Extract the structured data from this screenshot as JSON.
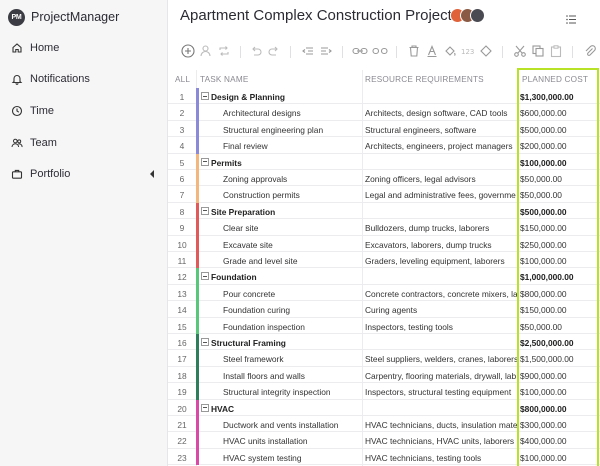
{
  "app": {
    "brand_abbr": "PM",
    "brand_name": "ProjectManager"
  },
  "sidebar": {
    "items": [
      {
        "label": "Home",
        "icon": "home-icon"
      },
      {
        "label": "Notifications",
        "icon": "bell-icon"
      },
      {
        "label": "Time",
        "icon": "clock-icon"
      },
      {
        "label": "Team",
        "icon": "team-icon"
      },
      {
        "label": "Portfolio",
        "icon": "briefcase-icon"
      }
    ]
  },
  "header": {
    "title": "Apartment Complex Construction Project"
  },
  "colors": {
    "highlight": "#b7e225",
    "design": "#8b8ad9",
    "permits": "#f3b77d",
    "site": "#e15a5a",
    "foundation": "#58c77a",
    "framing": "#2e7d5b",
    "hvac": "#d94aa6"
  },
  "grid": {
    "columns": {
      "all": "ALL",
      "task": "TASK NAME",
      "resource": "RESOURCE REQUIREMENTS",
      "cost": "PLANNED COST"
    },
    "rows": [
      {
        "num": "1",
        "name": "Design & Planning",
        "resource": "",
        "cost": "$1,300,000.00",
        "group": true,
        "color": "design"
      },
      {
        "num": "2",
        "name": "Architectural designs",
        "resource": "Architects, design software, CAD tools",
        "cost": "$600,000.00",
        "group": false,
        "color": "design"
      },
      {
        "num": "3",
        "name": "Structural engineering plan",
        "resource": "Structural engineers, software",
        "cost": "$500,000.00",
        "group": false,
        "color": "design"
      },
      {
        "num": "4",
        "name": "Final review",
        "resource": "Architects, engineers, project managers",
        "cost": "$200,000.00",
        "group": false,
        "color": "design"
      },
      {
        "num": "5",
        "name": "Permits",
        "resource": "",
        "cost": "$100,000.00",
        "group": true,
        "color": "permits"
      },
      {
        "num": "6",
        "name": "Zoning approvals",
        "resource": "Zoning officers, legal advisors",
        "cost": "$50,000.00",
        "group": false,
        "color": "permits"
      },
      {
        "num": "7",
        "name": "Construction permits",
        "resource": "Legal and administrative fees, governme",
        "cost": "$50,000.00",
        "group": false,
        "color": "permits"
      },
      {
        "num": "8",
        "name": "Site Preparation",
        "resource": "",
        "cost": "$500,000.00",
        "group": true,
        "color": "site"
      },
      {
        "num": "9",
        "name": "Clear site",
        "resource": "Bulldozers, dump trucks, laborers",
        "cost": "$150,000.00",
        "group": false,
        "color": "site"
      },
      {
        "num": "10",
        "name": "Excavate site",
        "resource": "Excavators, laborers, dump trucks",
        "cost": "$250,000.00",
        "group": false,
        "color": "site"
      },
      {
        "num": "11",
        "name": "Grade and level site",
        "resource": "Graders, leveling equipment, laborers",
        "cost": "$100,000.00",
        "group": false,
        "color": "site"
      },
      {
        "num": "12",
        "name": "Foundation",
        "resource": "",
        "cost": "$1,000,000.00",
        "group": true,
        "color": "foundation"
      },
      {
        "num": "13",
        "name": "Pour concrete",
        "resource": "Concrete contractors, concrete mixers, la",
        "cost": "$800,000.00",
        "group": false,
        "color": "foundation"
      },
      {
        "num": "14",
        "name": "Foundation curing",
        "resource": "Curing agents",
        "cost": "$150,000.00",
        "group": false,
        "color": "foundation"
      },
      {
        "num": "15",
        "name": "Foundation inspection",
        "resource": "Inspectors, testing tools",
        "cost": "$50,000.00",
        "group": false,
        "color": "foundation"
      },
      {
        "num": "16",
        "name": "Structural Framing",
        "resource": "",
        "cost": "$2,500,000.00",
        "group": true,
        "color": "framing"
      },
      {
        "num": "17",
        "name": "Steel framework",
        "resource": "Steel suppliers, welders, cranes, laborers",
        "cost": "$1,500,000.00",
        "group": false,
        "color": "framing"
      },
      {
        "num": "18",
        "name": "Install floors and walls",
        "resource": "Carpentry, flooring materials, drywall, lab",
        "cost": "$900,000.00",
        "group": false,
        "color": "framing"
      },
      {
        "num": "19",
        "name": "Structural integrity inspection",
        "resource": "Inspectors, structural testing equipment",
        "cost": "$100,000.00",
        "group": false,
        "color": "framing"
      },
      {
        "num": "20",
        "name": "HVAC",
        "resource": "",
        "cost": "$800,000.00",
        "group": true,
        "color": "hvac"
      },
      {
        "num": "21",
        "name": "Ductwork and vents installation",
        "resource": "HVAC technicians, ducts, insulation mate",
        "cost": "$300,000.00",
        "group": false,
        "color": "hvac"
      },
      {
        "num": "22",
        "name": "HVAC units installation",
        "resource": "HVAC technicians, HVAC units, laborers",
        "cost": "$400,000.00",
        "group": false,
        "color": "hvac"
      },
      {
        "num": "23",
        "name": "HVAC system testing",
        "resource": "HVAC technicians, testing tools",
        "cost": "$100,000.00",
        "group": false,
        "color": "hvac"
      }
    ]
  }
}
